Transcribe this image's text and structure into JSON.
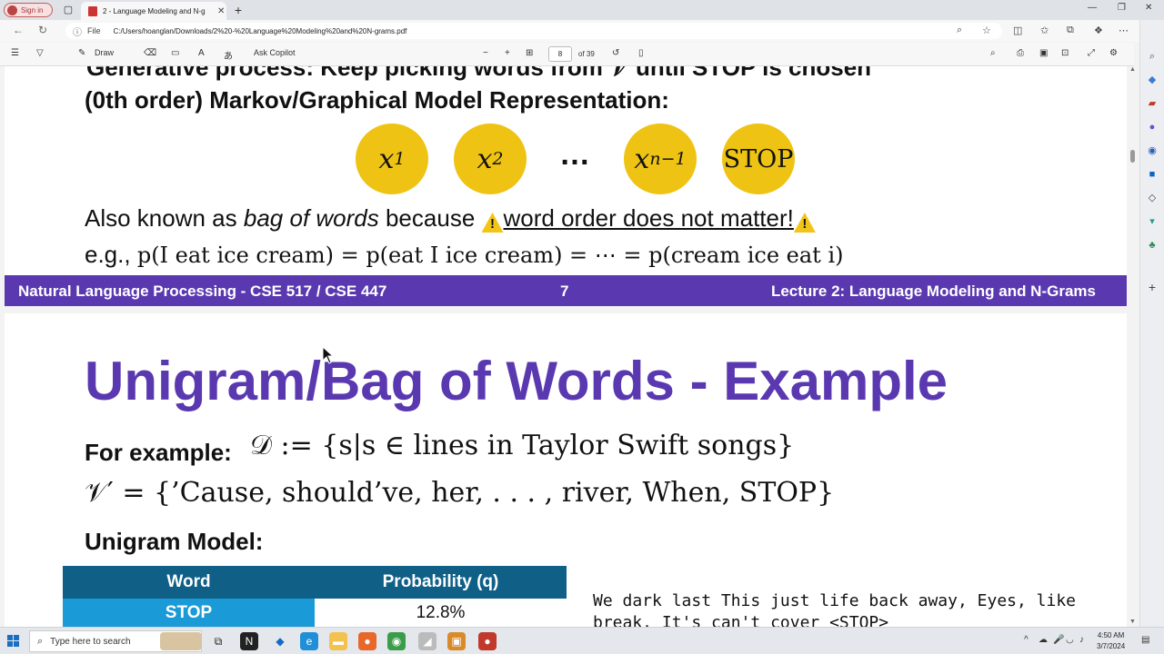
{
  "browser": {
    "signin_label": "Sign in",
    "tab_title": "2 - Language Modeling and N-g",
    "tab_close": "✕",
    "new_tab": "+",
    "file_label": "File",
    "url": "C:/Users/hoanglan/Downloads/2%20-%20Language%20Modeling%20and%20N-grams.pdf",
    "min": "—",
    "max": "❐",
    "close": "✕"
  },
  "pdf_toolbar": {
    "draw_label": "Draw",
    "ask_copilot_label": "Ask Copilot",
    "zoom_out": "−",
    "zoom_in": "+",
    "page_current": "8",
    "page_total": "of 39"
  },
  "slide1": {
    "cut_text": "Generative process: Keep picking words from  𝒱  until  STOP  is chosen",
    "heading": "(0th order) Markov/Graphical Model Representation:",
    "nodes": {
      "n1_var": "x",
      "n1_sub": "1",
      "n2_var": "x",
      "n2_sub": "2",
      "dots": "…",
      "n3_var": "x",
      "n3_sub": "n−1",
      "n4": "STOP"
    },
    "aka_prefix": "Also known as ",
    "aka_em": "bag of words",
    "aka_mid": " because ",
    "warn_glyph": "!",
    "aka_underline": "word order does not matter!",
    "eg_prefix": "e.g., ",
    "eg_math": "p(I eat ice cream) = p(eat I ice cream) = ⋯ = p(cream ice eat i)",
    "footer_left": "Natural Language Processing - CSE 517 / CSE 447",
    "footer_center": "7",
    "footer_right": "Lecture 2: Language Modeling and N-Grams"
  },
  "slide2": {
    "title": "Unigram/Bag of Words - Example",
    "for_example_label": "For example:",
    "dataset_def": "𝒟 := {s|s ∈ lines in Taylor Swift songs}",
    "vocab_def": "𝒱′ = {’Cause, should’ve, her, . . . , river, When, STOP}",
    "unigram_label": "Unigram Model:",
    "table": {
      "col_word": "Word",
      "col_prob": "Probability (q)",
      "rows": [
        {
          "word": "STOP",
          "prob": "12.8%"
        }
      ]
    },
    "generated_text": "We dark last This just life back away, Eyes, like\nbreak. It's can't cover <STOP>"
  },
  "taskbar": {
    "search_placeholder": "Type here to search",
    "time": "4:50 AM",
    "date": "3/7/2024"
  },
  "colors": {
    "purple": "#5a39b0",
    "node_yellow": "#eec313",
    "table_header": "#0f5f87",
    "table_word": "#1a9ad6"
  }
}
